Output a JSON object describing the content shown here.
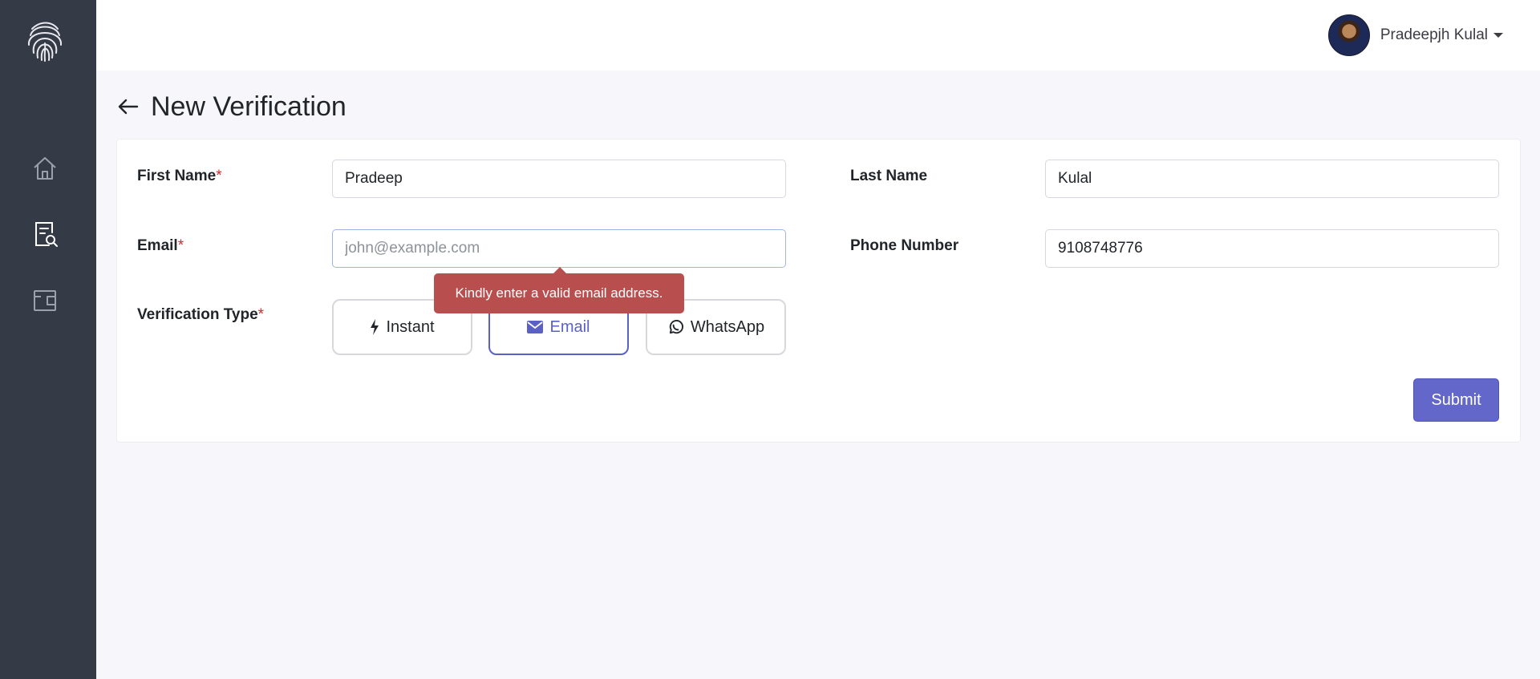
{
  "sidebar": {
    "logo_icon": "fingerprint-icon",
    "items": [
      {
        "icon": "home-icon"
      },
      {
        "icon": "verification-search-icon"
      },
      {
        "icon": "wallet-icon"
      }
    ]
  },
  "header": {
    "user_name": "Pradeepjh Kulal",
    "avatar_icon": "avatar"
  },
  "page": {
    "title": "New Verification",
    "back_icon": "arrow-left-icon"
  },
  "form": {
    "first_name": {
      "label": "First Name",
      "required": "*",
      "value": "Pradeep"
    },
    "last_name": {
      "label": "Last Name",
      "value": "Kulal"
    },
    "email": {
      "label": "Email",
      "required": "*",
      "value": "",
      "placeholder": "john@example.com"
    },
    "phone": {
      "label": "Phone Number",
      "value": "9108748776"
    },
    "verification_type": {
      "label": "Verification Type",
      "required": "*",
      "options": [
        {
          "label": "Instant",
          "icon": "bolt-icon"
        },
        {
          "label": "Email",
          "icon": "envelope-icon"
        },
        {
          "label": "WhatsApp",
          "icon": "whatsapp-icon"
        }
      ],
      "selected": "Email"
    },
    "validation_message": "Kindly enter a valid email address.",
    "submit_label": "Submit"
  },
  "colors": {
    "sidebar_bg": "#343a46",
    "accent": "#5b61c4",
    "error": "#b94e4f",
    "required_marker": "#d9262c"
  }
}
